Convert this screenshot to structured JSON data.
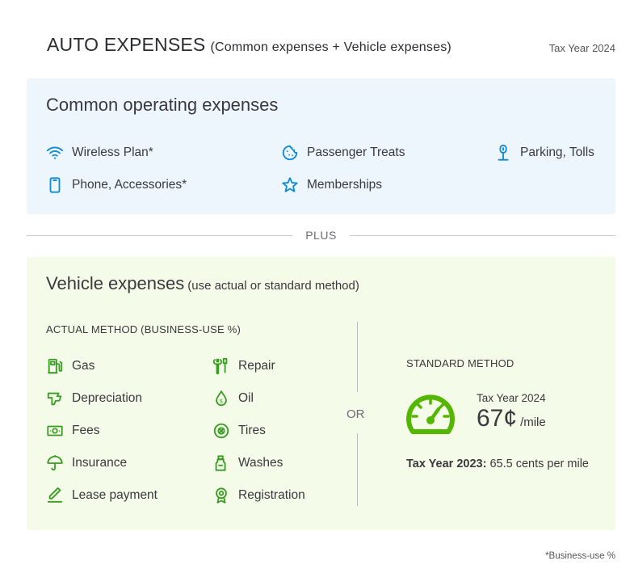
{
  "header": {
    "title": "AUTO EXPENSES",
    "subtitle": "(Common expenses + Vehicle expenses)",
    "tax_year": "Tax Year 2024"
  },
  "common": {
    "heading": "Common operating expenses",
    "items": [
      {
        "label": "Wireless Plan*",
        "icon": "wifi-icon"
      },
      {
        "label": "Phone, Accessories*",
        "icon": "phone-icon"
      },
      {
        "label": "Passenger Treats",
        "icon": "cookie-icon"
      },
      {
        "label": "Memberships",
        "icon": "star-icon"
      },
      {
        "label": "Parking, Tolls",
        "icon": "parking-meter-icon"
      }
    ]
  },
  "plus_label": "PLUS",
  "vehicle": {
    "heading": "Vehicle expenses",
    "subheading": "(use actual or standard method)",
    "actual_label": "ACTUAL METHOD (BUSINESS-USE %)",
    "actual_items_left": [
      {
        "label": "Gas",
        "icon": "gas-pump-icon"
      },
      {
        "label": "Depreciation",
        "icon": "depreciation-icon"
      },
      {
        "label": "Fees",
        "icon": "money-icon"
      },
      {
        "label": "Insurance",
        "icon": "umbrella-icon"
      },
      {
        "label": "Lease payment",
        "icon": "signature-icon"
      }
    ],
    "actual_items_right": [
      {
        "label": "Repair",
        "icon": "wrench-icon"
      },
      {
        "label": "Oil",
        "icon": "oil-drop-icon"
      },
      {
        "label": "Tires",
        "icon": "tire-icon"
      },
      {
        "label": "Washes",
        "icon": "spray-bottle-icon"
      },
      {
        "label": "Registration",
        "icon": "award-icon"
      }
    ],
    "or_label": "OR",
    "standard_label": "STANDARD METHOD",
    "rate_year": "Tax Year 2024",
    "rate_value": "67¢",
    "rate_unit": "/mile",
    "prev_label": "Tax Year 2023:",
    "prev_value": "65.5 cents per mile"
  },
  "footnote": "*Business-use %",
  "colors": {
    "blue_icon": "#0d8ad8",
    "green_icon": "#3a9d23",
    "gauge_green": "#53b700",
    "common_bg": "#edf6fd",
    "vehicle_bg": "#f4fbe9"
  }
}
